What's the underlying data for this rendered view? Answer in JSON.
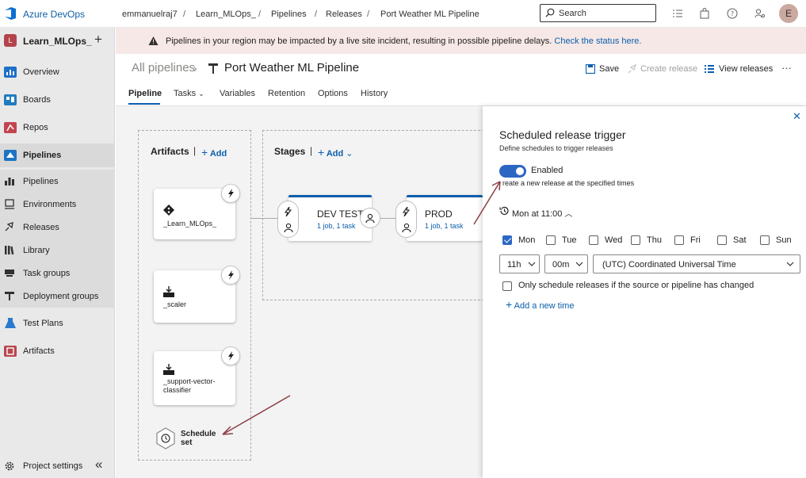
{
  "topbar": {
    "brand": "Azure DevOps",
    "breadcrumbs": [
      "emmanuelraj7",
      "Learn_MLOps_",
      "Pipelines",
      "Releases",
      "Port Weather ML Pipeline"
    ],
    "search_placeholder": "Search",
    "user_initial": "E"
  },
  "sidebar": {
    "project_initial": "L",
    "project_name": "Learn_MLOps_",
    "items": [
      {
        "label": "Overview",
        "icon": "overview-icon"
      },
      {
        "label": "Boards",
        "icon": "boards-icon"
      },
      {
        "label": "Repos",
        "icon": "repos-icon"
      },
      {
        "label": "Pipelines",
        "icon": "pipelines-icon"
      },
      {
        "label": "Pipelines",
        "icon": "pipelines-sub-icon"
      },
      {
        "label": "Environments",
        "icon": "environments-icon"
      },
      {
        "label": "Releases",
        "icon": "releases-icon"
      },
      {
        "label": "Library",
        "icon": "library-icon"
      },
      {
        "label": "Task groups",
        "icon": "task-groups-icon"
      },
      {
        "label": "Deployment groups",
        "icon": "deployment-groups-icon"
      },
      {
        "label": "Test Plans",
        "icon": "test-plans-icon"
      },
      {
        "label": "Artifacts",
        "icon": "artifacts-icon"
      }
    ],
    "settings_label": "Project settings"
  },
  "banner": {
    "message": "Pipelines in your region may be impacted by a live site incident, resulting in possible pipeline delays.",
    "link": "Check the status here."
  },
  "header": {
    "all_pipelines": "All pipelines",
    "title": "Port Weather ML Pipeline",
    "save": "Save",
    "create_release": "Create release",
    "view_releases": "View releases",
    "more": "···"
  },
  "tabs": [
    "Pipeline",
    "Tasks",
    "Variables",
    "Retention",
    "Options",
    "History"
  ],
  "canvas": {
    "artifacts_label": "Artifacts",
    "stages_label": "Stages",
    "add_label": "Add",
    "artifacts": [
      "_Learn_MLOps_",
      "_scaler",
      "_support-vector-classifier"
    ],
    "stages": [
      {
        "name": "DEV TEST",
        "info": "1 job, 1 task"
      },
      {
        "name": "PROD",
        "info": "1 job, 1 task"
      }
    ],
    "schedule_line1": "Schedule",
    "schedule_line2": "set"
  },
  "panel": {
    "title": "Scheduled release trigger",
    "subtitle": "Define schedules to trigger releases",
    "toggle_label": "Enabled",
    "toggle_desc": "reate a new release at the specified times",
    "schedule_summary": "Mon at 11:00",
    "days": [
      {
        "label": "Mon",
        "checked": true
      },
      {
        "label": "Tue",
        "checked": false
      },
      {
        "label": "Wed",
        "checked": false
      },
      {
        "label": "Thu",
        "checked": false
      },
      {
        "label": "Fri",
        "checked": false
      },
      {
        "label": "Sat",
        "checked": false
      },
      {
        "label": "Sun",
        "checked": false
      }
    ],
    "hour": "11h",
    "minute": "00m",
    "timezone": "(UTC) Coordinated Universal Time",
    "only_changed": "Only schedule releases if the source or pipeline has changed",
    "add_time": "Add a new time"
  },
  "colors": {
    "accent": "#0b5fad",
    "toggle": "#2c66c3",
    "annotation_arrow": "#8c3f46"
  }
}
